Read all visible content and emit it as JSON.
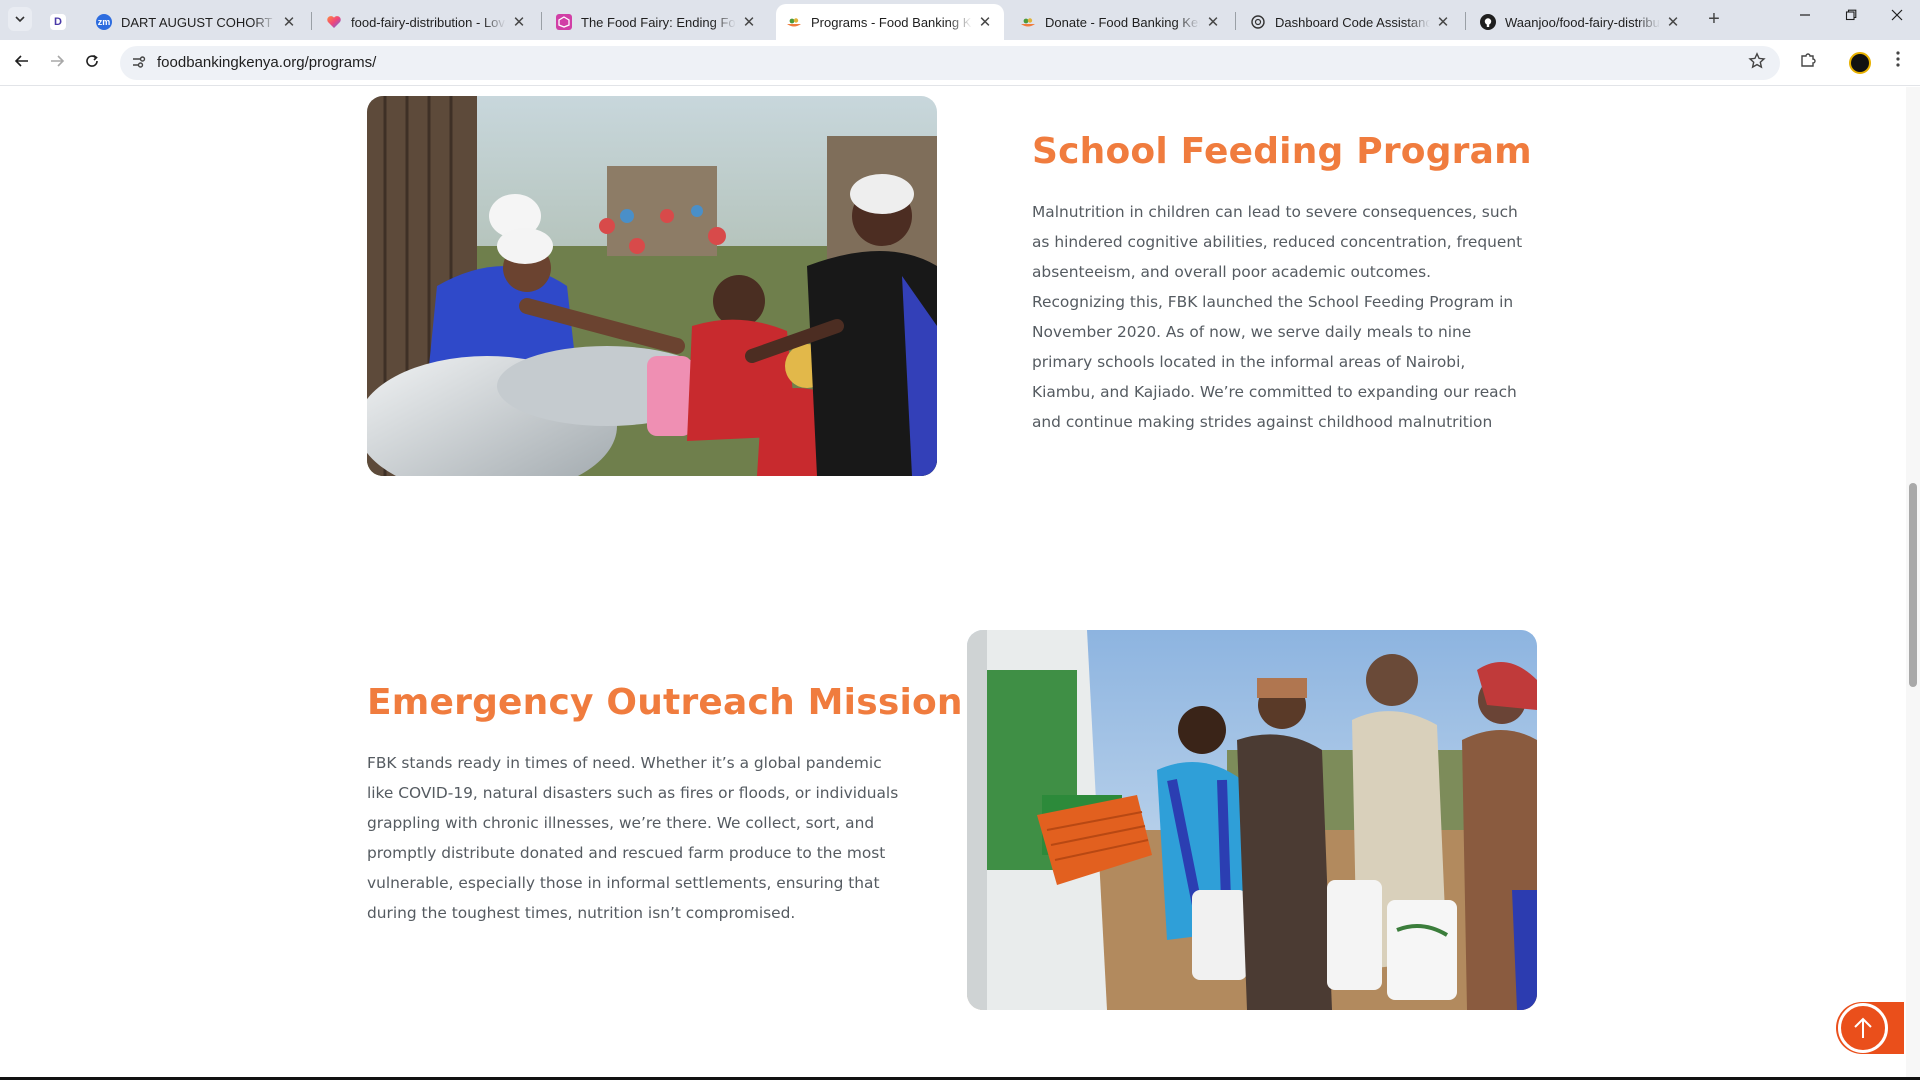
{
  "browser": {
    "tabs": [
      {
        "title": "DART AUGUST COHORT SESSI",
        "favicon": "zoom-icon",
        "active": false
      },
      {
        "title": "food-fairy-distribution - Lovab",
        "favicon": "lovable-heart-icon",
        "active": false
      },
      {
        "title": "The Food Fairy: Ending Food W",
        "favicon": "food-fairy-icon",
        "active": false
      },
      {
        "title": "Programs - Food Banking Ken",
        "favicon": "food-banking-icon",
        "active": true
      },
      {
        "title": "Donate - Food Banking Kenya",
        "favicon": "food-banking-icon",
        "active": false
      },
      {
        "title": "Dashboard Code Assistance",
        "favicon": "chatgpt-icon",
        "active": false
      },
      {
        "title": "Waanjoo/food-fairy-distributi",
        "favicon": "github-icon",
        "active": false
      }
    ],
    "url": "foodbankingkenya.org/programs/",
    "close_glyph": "✕",
    "new_tab_glyph": "+"
  },
  "page": {
    "sections": [
      {
        "heading": "School Feeding Program",
        "body": "Malnutrition in children can lead to severe consequences, such as hindered cognitive abilities, reduced concentration, frequent absenteeism, and overall poor academic outcomes. Recognizing this, FBK launched the School Feeding Program in November 2020. As of now, we serve daily meals to nine primary schools located in the informal areas of Nairobi, Kiambu, and Kajiado. We’re committed to expanding our reach and continue making strides against childhood malnutrition",
        "image_subject": "school-feeding-photo"
      },
      {
        "heading": "Emergency Outreach Mission",
        "body": "FBK stands ready in times of need. Whether it’s a global pandemic like COVID-19, natural disasters such as fires or floods, or individuals grappling with chronic illnesses, we’re there. We collect, sort, and promptly distribute donated and rescued farm produce to the most vulnerable, especially those in informal settlements, ensuring that during the toughest times, nutrition isn’t compromised.",
        "image_subject": "emergency-outreach-photo"
      }
    ]
  },
  "colors": {
    "heading": "#f07c3e",
    "body_text": "#555b61",
    "back_to_top": "#ea4f1b"
  }
}
